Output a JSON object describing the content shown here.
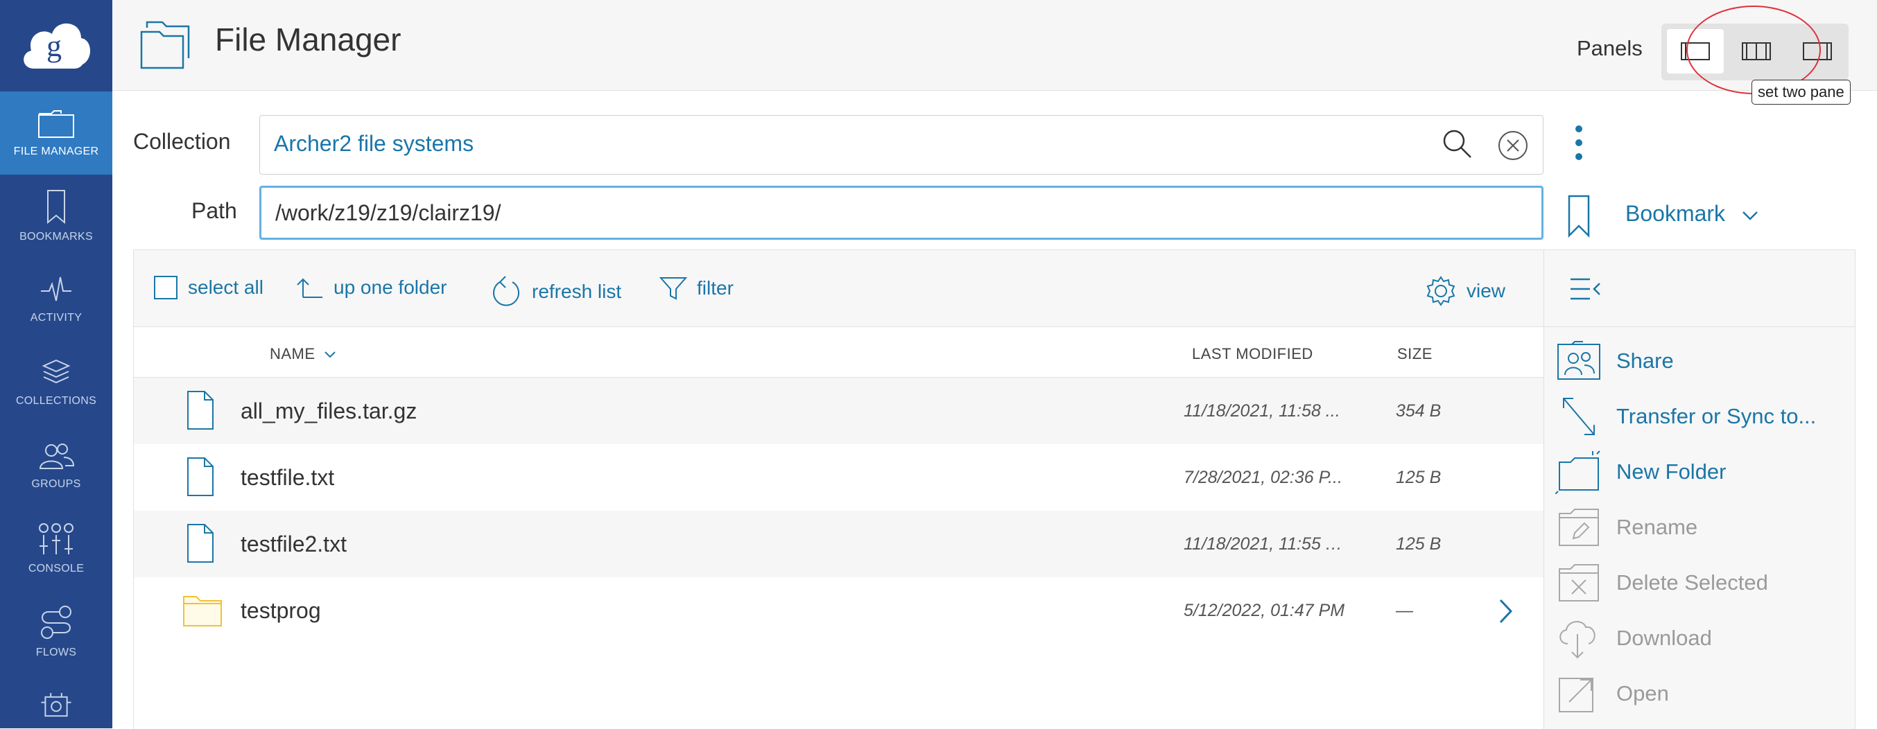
{
  "app": {
    "title": "File Manager"
  },
  "sidebar": {
    "items": [
      {
        "label": "FILE MANAGER",
        "icon": "file-manager-icon",
        "active": true
      },
      {
        "label": "BOOKMARKS",
        "icon": "bookmark-icon",
        "active": false
      },
      {
        "label": "ACTIVITY",
        "icon": "activity-icon",
        "active": false
      },
      {
        "label": "COLLECTIONS",
        "icon": "collections-icon",
        "active": false
      },
      {
        "label": "GROUPS",
        "icon": "groups-icon",
        "active": false
      },
      {
        "label": "CONSOLE",
        "icon": "console-icon",
        "active": false
      },
      {
        "label": "FLOWS",
        "icon": "flows-icon",
        "active": false
      }
    ]
  },
  "header": {
    "panels_label": "Panels",
    "tooltip": "set two pane"
  },
  "collection": {
    "label": "Collection",
    "value": "Archer2 file systems"
  },
  "path": {
    "label": "Path",
    "value": "/work/z19/z19/clairz19/"
  },
  "bookmark": {
    "label": "Bookmark"
  },
  "toolbar": {
    "select_all": "select all",
    "up_one_folder": "up one folder",
    "refresh_list": "refresh list",
    "filter": "filter",
    "view": "view"
  },
  "columns": {
    "name": "NAME",
    "last_modified": "LAST MODIFIED",
    "size": "SIZE"
  },
  "files": [
    {
      "name": "all_my_files.tar.gz",
      "modified": "11/18/2021, 11:58 ...",
      "size": "354 B",
      "type": "file"
    },
    {
      "name": "testfile.txt",
      "modified": "7/28/2021, 02:36 P...",
      "size": "125 B",
      "type": "file"
    },
    {
      "name": "testfile2.txt",
      "modified": "11/18/2021, 11:55 A...",
      "size": "125 B",
      "type": "file"
    },
    {
      "name": "testprog",
      "modified": "5/12/2022, 01:47 PM",
      "size": "—",
      "type": "folder"
    }
  ],
  "actions": [
    {
      "label": "Share",
      "enabled": true
    },
    {
      "label": "Transfer or Sync to...",
      "enabled": true
    },
    {
      "label": "New Folder",
      "enabled": true
    },
    {
      "label": "Rename",
      "enabled": false
    },
    {
      "label": "Delete Selected",
      "enabled": false
    },
    {
      "label": "Download",
      "enabled": false
    },
    {
      "label": "Open",
      "enabled": false
    }
  ],
  "colors": {
    "sidebar": "#26488a",
    "sidebar_active": "#2f7ac1",
    "accent": "#1a76a8",
    "annotation": "#e0303a"
  }
}
